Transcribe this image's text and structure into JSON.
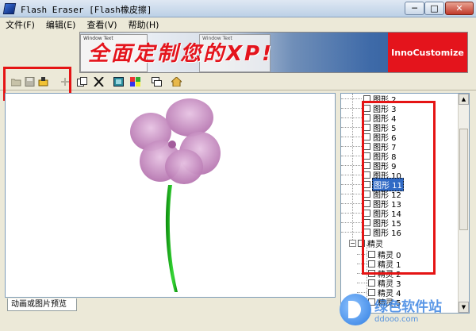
{
  "window": {
    "title": "Flash Eraser [Flash橡皮擦]",
    "min_glyph": "─",
    "max_glyph": "□",
    "close_glyph": "✕"
  },
  "menu": [
    "文件(F)",
    "编辑(E)",
    "查看(V)",
    "帮助(H)"
  ],
  "banner": {
    "slogan": "全面定制您的XP!",
    "brand": "InnoCustomize",
    "thumb1_label": "Window Text",
    "thumb2_label": "Window Text"
  },
  "toolbar": {
    "icons": [
      "open-icon",
      "save-icon",
      "export-icon",
      "add-icon",
      "copy-icon",
      "delete-icon",
      "preview-icon",
      "palette-icon",
      "windows-icon",
      "home-icon"
    ]
  },
  "preview": {
    "tab_label": "动画或图片预览"
  },
  "tree": {
    "shapes": [
      "图形 2",
      "图形 3",
      "图形 4",
      "图形 5",
      "图形 6",
      "图形 7",
      "图形 8",
      "图形 9",
      "图形 10",
      "图形 11",
      "图形 12",
      "图形 13",
      "图形 14",
      "图形 15",
      "图形 16"
    ],
    "selected_shape": "图形 11",
    "group_expander": "−",
    "group_label": "精灵",
    "sprites": [
      "精灵 0",
      "精灵 1",
      "精灵 2",
      "精灵 3",
      "精灵 4",
      "精灵 5"
    ]
  },
  "watermark": {
    "text": "绿色软件站",
    "url": "ddooo.com"
  },
  "colors": {
    "highlight": "#e51414",
    "selection": "#316ac5",
    "petal": "#c98bc4",
    "stem": "#1db31d"
  }
}
